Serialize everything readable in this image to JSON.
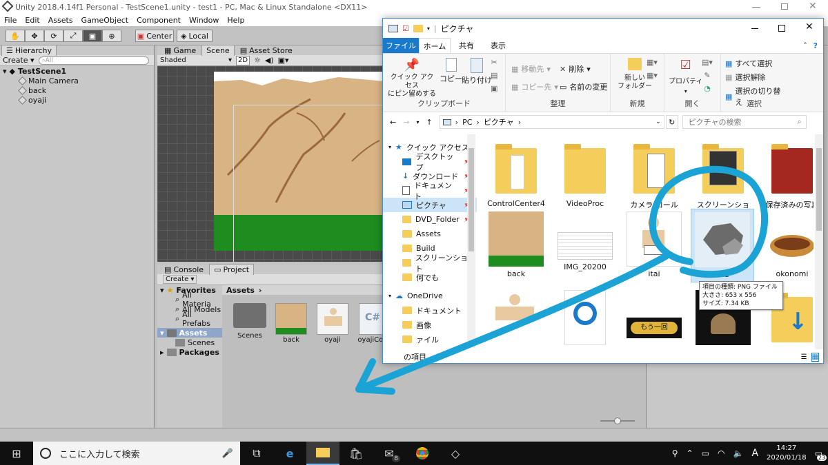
{
  "unity": {
    "title": "Unity 2018.4.14f1 Personal - TestScene1.unity - test1 - PC, Mac & Linux Standalone <DX11>",
    "menu": [
      "File",
      "Edit",
      "Assets",
      "GameObject",
      "Component",
      "Window",
      "Help"
    ],
    "toolbar": {
      "center": "Center",
      "local": "Local"
    },
    "hierarchy": {
      "tab": "Hierarchy",
      "create": "Create",
      "search_placeholder": "All",
      "scene": "TestScene1",
      "items": [
        "Main Camera",
        "back",
        "oyaji"
      ]
    },
    "scene": {
      "tabs": [
        "Game",
        "Scene",
        "Asset Store"
      ],
      "shading": "Shaded",
      "mode_2d": "2D"
    },
    "bottom_tabs": [
      "Console",
      "Project"
    ],
    "project": {
      "create": "Create",
      "favorites": "Favorites",
      "fav_items": [
        "All Materia",
        "All Models",
        "All Prefabs"
      ],
      "assets": "Assets",
      "assets_children": [
        "Scenes"
      ],
      "packages": "Packages",
      "breadcrumb": "Assets",
      "items": [
        "Scenes",
        "back",
        "oyaji",
        "oyajiCon"
      ]
    }
  },
  "explorer": {
    "title": "ピクチャ",
    "ribbon_tabs": [
      "ファイル",
      "ホーム",
      "共有",
      "表示"
    ],
    "ribbon": {
      "clipboard": {
        "label": "クリップボード",
        "pin": "クイック アクセス\nにピン留めする",
        "copy": "コピー",
        "paste": "貼り付け"
      },
      "organize": {
        "label": "整理",
        "move": "移動先",
        "copy_to": "コピー先",
        "delete": "削除",
        "rename": "名前の変更"
      },
      "new": {
        "label": "新規",
        "new_folder": "新しい\nフォルダー"
      },
      "open": {
        "label": "開く",
        "properties": "プロパティ"
      },
      "select": {
        "label": "選択",
        "all": "すべて選択",
        "none": "選択解除",
        "invert": "選択の切り替え"
      }
    },
    "path": [
      "PC",
      "ピクチャ"
    ],
    "search_placeholder": "ピクチャの検索",
    "nav": [
      {
        "label": "クイック アクセス",
        "pin": false
      },
      {
        "label": "デスクトップ",
        "pin": true
      },
      {
        "label": "ダウンロード",
        "pin": true
      },
      {
        "label": "ドキュメント",
        "pin": true
      },
      {
        "label": "ピクチャ",
        "pin": true
      },
      {
        "label": "DVD_Folder",
        "pin": true
      },
      {
        "label": "Assets",
        "pin": false
      },
      {
        "label": "Build",
        "pin": false
      },
      {
        "label": "スクリーンショット",
        "pin": false
      },
      {
        "label": "何でも",
        "pin": false
      },
      {
        "label": "OneDrive",
        "pin": false
      },
      {
        "label": "ドキュメント",
        "pin": false
      },
      {
        "label": "画像",
        "pin": false
      },
      {
        "label": "ァイル",
        "pin": false
      }
    ],
    "files_row1": [
      "ControlCenter4",
      "VideoProc",
      "カメラ ロール",
      "スクリーンショット",
      "保存済みの写真"
    ],
    "files_row2": [
      "back",
      "IMG_20200",
      "itai",
      "iwa",
      "okonomi"
    ],
    "tooltip": {
      "type": "項目の種類: PNG ファイル",
      "size_px": "大きさ: 653 x 556",
      "size_kb": "サイズ: 7.34 KB"
    },
    "mou_ikkai": "もう一回",
    "status": "の項目"
  },
  "taskbar": {
    "search_placeholder": "ここに入力して検索",
    "time": "14:27",
    "date": "2020/01/18",
    "mail_badge": "8",
    "notif_badge": "23",
    "ime": "A"
  },
  "colors": {
    "annotation": "#1aa3d4",
    "accent": "#1979ca"
  }
}
